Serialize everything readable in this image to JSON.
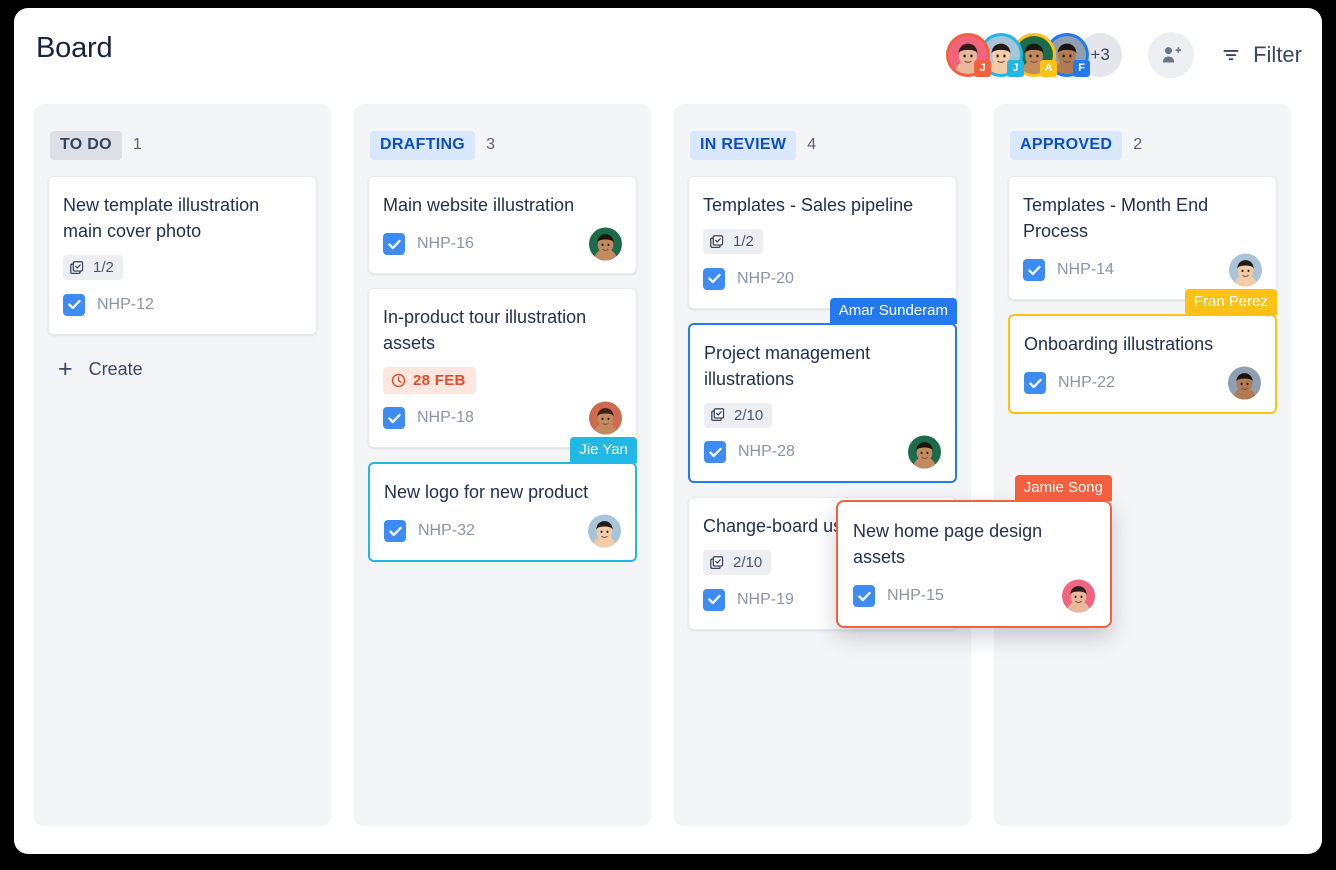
{
  "header": {
    "title": "Board",
    "more_count": "+3",
    "add_person_icon": "person-add-icon",
    "filter_icon": "filter-icon",
    "filter_label": "Filter",
    "avatars": [
      {
        "initial": "J",
        "ring_color": "#f4603e",
        "badge_color": "#f4603e",
        "skin": "#e8b89a",
        "hair": "#2c1f1a",
        "bg": "#f0647f"
      },
      {
        "initial": "J",
        "ring_color": "#21b8e8",
        "badge_color": "#21b8e8",
        "skin": "#f2cba8",
        "hair": "#241a16",
        "bg": "#a8c4d6"
      },
      {
        "initial": "A",
        "ring_color": "#ffc116",
        "badge_color": "#ffc116",
        "skin": "#c28a5e",
        "hair": "#1d1512",
        "bg": "#1c6b4a"
      },
      {
        "initial": "F",
        "ring_color": "#2479f0",
        "badge_color": "#2479f0",
        "skin": "#b07a52",
        "hair": "#1a1411",
        "bg": "#8f9fb0"
      }
    ]
  },
  "columns": [
    {
      "name": "TO DO",
      "pill_style": "grey",
      "count": "1",
      "cards": [
        {
          "title": "New template illustration main cover photo",
          "subtasks": "1/2",
          "key": "NHP-12",
          "avatar": null,
          "due": null
        }
      ],
      "create_label": "Create"
    },
    {
      "name": "DRAFTING",
      "pill_style": "blue",
      "count": "3",
      "cards": [
        {
          "title": "Main website illustration",
          "subtasks": null,
          "key": "NHP-16",
          "avatar": {
            "skin": "#c28a5e",
            "hair": "#1d1512",
            "bg": "#1c6b4a"
          },
          "due": null
        },
        {
          "title": "In-product tour illustration assets",
          "subtasks": null,
          "key": "NHP-18",
          "avatar": {
            "skin": "#c28a5e",
            "hair": "#3a2218",
            "bg": "#cf6a4e"
          },
          "due": "28 FEB"
        },
        {
          "title": "New logo for new product",
          "subtasks": null,
          "key": "NHP-32",
          "avatar": {
            "skin": "#f2cba8",
            "hair": "#241a16",
            "bg": "#a8c4d6"
          },
          "due": null,
          "selected_by": "Jie Yan",
          "select_color": "cyan"
        }
      ],
      "create_label": null
    },
    {
      "name": "IN REVIEW",
      "pill_style": "blue",
      "count": "4",
      "cards": [
        {
          "title": "Templates - Sales pipeline",
          "subtasks": "1/2",
          "key": "NHP-20",
          "avatar": null,
          "due": null
        },
        {
          "title": "Project management illustrations",
          "subtasks": "2/10",
          "key": "NHP-28",
          "avatar": {
            "skin": "#c28a5e",
            "hair": "#1d1512",
            "bg": "#1c6b4a"
          },
          "due": null,
          "selected_by": "Amar Sunderam",
          "select_color": "blue"
        },
        {
          "title": "Change-board users illustrations",
          "subtasks": "2/10",
          "key": "NHP-19",
          "avatar": {
            "skin": "#c28a5e",
            "hair": "#1d1512",
            "bg": "#1c6b4a"
          },
          "due": null
        }
      ],
      "create_label": null
    },
    {
      "name": "APPROVED",
      "pill_style": "blue",
      "count": "2",
      "cards": [
        {
          "title": "Templates - Month End Process",
          "subtasks": null,
          "key": "NHP-14",
          "avatar": {
            "skin": "#f2cba8",
            "hair": "#241a16",
            "bg": "#a8c4d6"
          },
          "due": null
        },
        {
          "title": "Onboarding illustrations",
          "subtasks": null,
          "key": "NHP-22",
          "avatar": {
            "skin": "#b07a52",
            "hair": "#1a1411",
            "bg": "#8f9fb0"
          },
          "due": null,
          "selected_by": "Fran Perez",
          "select_color": "yellow"
        }
      ],
      "create_label": null
    }
  ],
  "dragged_card": {
    "title": "New home page design assets",
    "key": "NHP-15",
    "cursor_label": "Jamie Song",
    "select_color": "orange",
    "avatar": {
      "skin": "#e8b89a",
      "hair": "#2c1f1a",
      "bg": "#f0647f"
    }
  }
}
